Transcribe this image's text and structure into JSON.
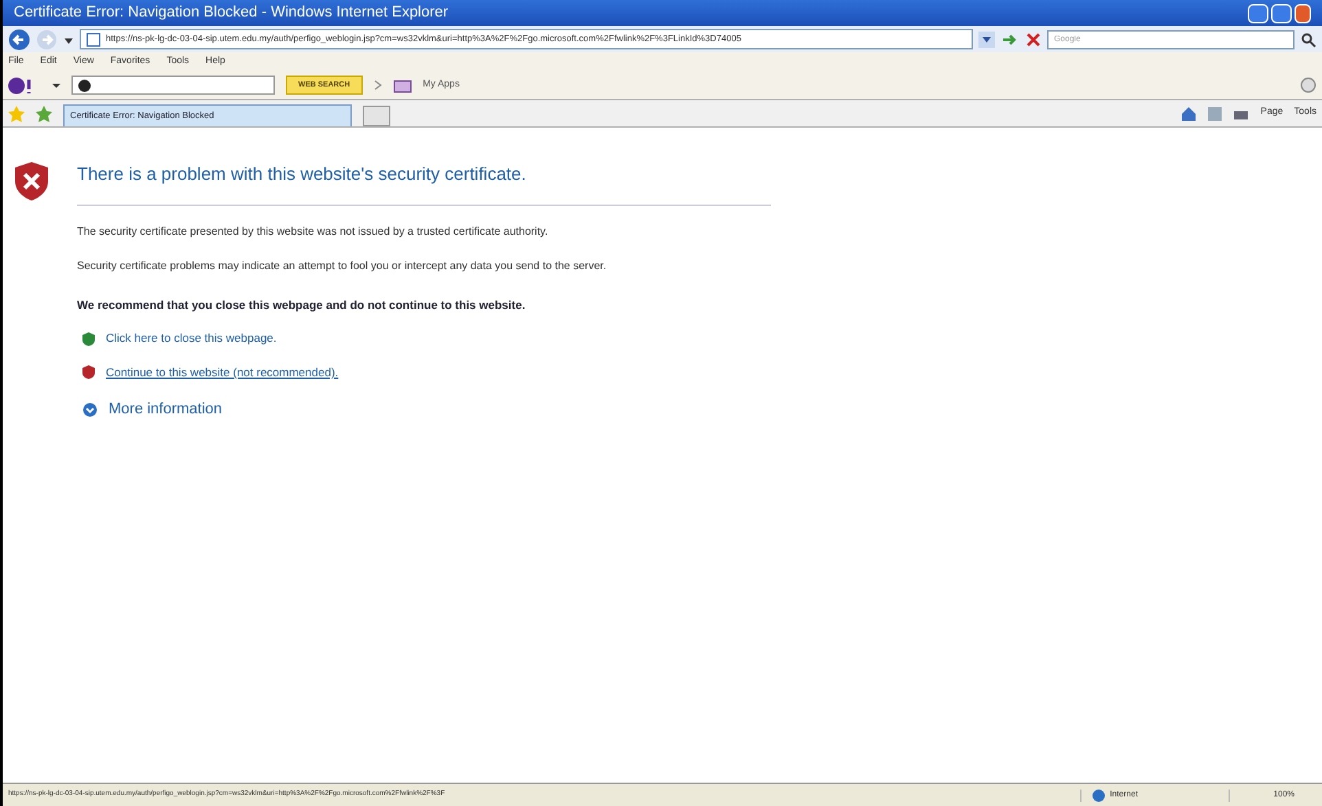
{
  "window": {
    "title": "Certificate Error: Navigation Blocked - Windows Internet Explorer"
  },
  "address_bar": {
    "url": "https://ns-pk-lg-dc-03-04-sip.utem.edu.my/auth/perfigo_weblogin.jsp?cm=ws32vklm&uri=http%3A%2F%2Fgo.microsoft.com%2Ffwlink%2F%3FLinkId%3D74005"
  },
  "search": {
    "placeholder": "Google"
  },
  "menu": [
    "File",
    "Edit",
    "View",
    "Favorites",
    "Tools",
    "Help"
  ],
  "toolbar": {
    "search_button": "WEB SEARCH",
    "apps_button": "My Apps"
  },
  "tabs": [
    {
      "label": "Certificate Error: Navigation Blocked",
      "selected": true
    }
  ],
  "commands": [
    "Page",
    "Tools"
  ],
  "content": {
    "heading": "There is a problem with this website's security certificate.",
    "paragraphs": [
      "The security certificate presented by this website was not issued by a trusted certificate authority.",
      "Security certificate problems may indicate an attempt to fool you or intercept any data you send to the server."
    ],
    "recommendation": "We recommend that you close this webpage and do not continue to this website.",
    "links": [
      {
        "kind": "safe",
        "label": "Click here to close this webpage."
      },
      {
        "kind": "unsafe",
        "label": "Continue to this website (not recommended)."
      }
    ],
    "more": "More information"
  },
  "status_bar": {
    "url": "https://ns-pk-lg-dc-03-04-sip.utem.edu.my/auth/perfigo_weblogin.jsp?cm=ws32vklm&uri=http%3A%2F%2Fgo.microsoft.com%2Ffwlink%2F%3F",
    "zone": "Internet",
    "zoom": "100%"
  }
}
